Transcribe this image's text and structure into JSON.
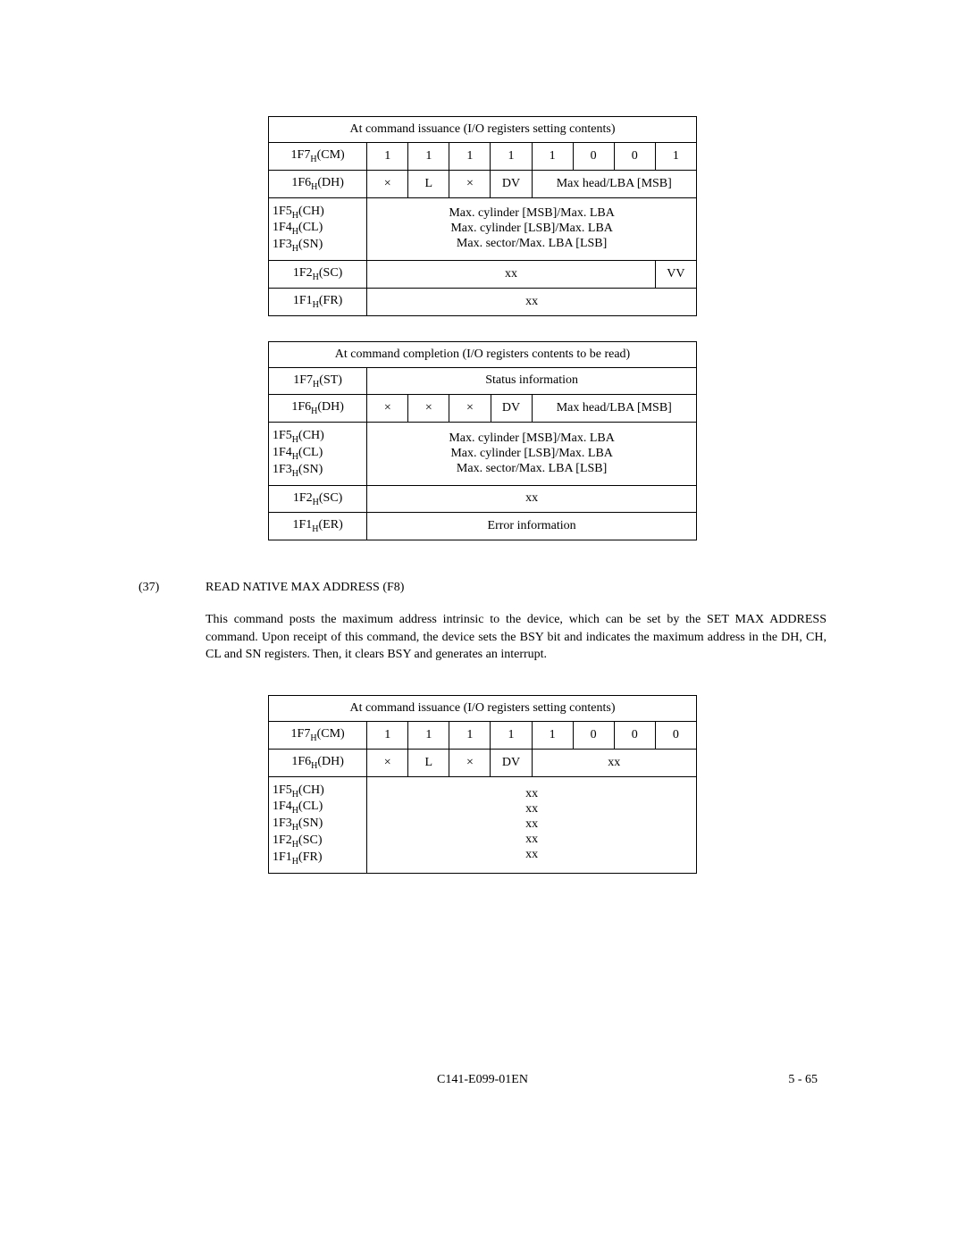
{
  "table1": {
    "title": "At command issuance (I/O registers setting contents)",
    "r1_label": "1F7_H(CM)",
    "r1_b7": "1",
    "r1_b6": "1",
    "r1_b5": "1",
    "r1_b4": "1",
    "r1_b3": "1",
    "r1_b2": "0",
    "r1_b1": "0",
    "r1_b0": "1",
    "r2_label": "1F6_H(DH)",
    "r2_c0": "×",
    "r2_c1": "L",
    "r2_c2": "×",
    "r2_c3": "DV",
    "r2_rest": "Max head/LBA [MSB]",
    "r3_label_l1": "1F5_H(CH)",
    "r3_label_l2": "1F4_H(CL)",
    "r3_label_l3": "1F3_H(SN)",
    "r3_v_l1": "Max. cylinder [MSB]/Max. LBA",
    "r3_v_l2": "Max. cylinder [LSB]/Max. LBA",
    "r3_v_l3": "Max. sector/Max. LBA [LSB]",
    "r4_label": "1F2_H(SC)",
    "r4_v1": "xx",
    "r4_v2": "VV",
    "r5_label": "1F1_H(FR)",
    "r5_v": "xx"
  },
  "table2": {
    "title": "At command completion (I/O registers contents to be read)",
    "r1_label": "1F7_H(ST)",
    "r1_v": "Status information",
    "r2_label": "1F6_H(DH)",
    "r2_c0": "×",
    "r2_c1": "×",
    "r2_c2": "×",
    "r2_c3": "DV",
    "r2_rest": "Max head/LBA [MSB]",
    "r3_label_l1": "1F5_H(CH)",
    "r3_label_l2": "1F4_H(CL)",
    "r3_label_l3": "1F3_H(SN)",
    "r3_v_l1": "Max. cylinder [MSB]/Max. LBA",
    "r3_v_l2": "Max. cylinder [LSB]/Max. LBA",
    "r3_v_l3": "Max. sector/Max. LBA [LSB]",
    "r4_label": "1F2_H(SC)",
    "r4_v": "xx",
    "r5_label": "1F1_H(ER)",
    "r5_v": "Error information"
  },
  "section": {
    "num": "(37)",
    "title": "READ NATIVE MAX ADDRESS (F8)",
    "para": "This command posts the maximum address intrinsic to the device, which can be set by the SET MAX ADDRESS command. Upon receipt of this command, the device sets the BSY bit and indicates the maximum address in the DH, CH, CL and SN registers. Then, it clears BSY and generates an interrupt."
  },
  "table3": {
    "title": "At command issuance (I/O registers setting contents)",
    "r1_label": "1F7_H(CM)",
    "r1_b7": "1",
    "r1_b6": "1",
    "r1_b5": "1",
    "r1_b4": "1",
    "r1_b3": "1",
    "r1_b2": "0",
    "r1_b1": "0",
    "r1_b0": "0",
    "r2_label": "1F6_H(DH)",
    "r2_c0": "×",
    "r2_c1": "L",
    "r2_c2": "×",
    "r2_c3": "DV",
    "r2_rest": "xx",
    "r3_label_l1": "1F5_H(CH)",
    "r3_label_l2": "1F4_H(CL)",
    "r3_label_l3": "1F3_H(SN)",
    "r3_label_l4": "1F2_H(SC)",
    "r3_label_l5": "1F1_H(FR)",
    "r3_v_l1": "xx",
    "r3_v_l2": "xx",
    "r3_v_l3": "xx",
    "r3_v_l4": "xx",
    "r3_v_l5": "xx"
  },
  "footer": {
    "center": "C141-E099-01EN",
    "right": "5 - 65"
  }
}
